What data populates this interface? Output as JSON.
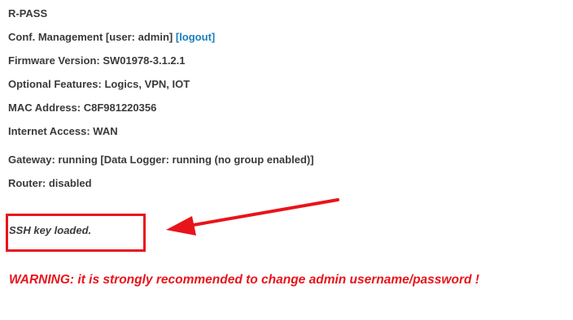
{
  "device": {
    "name": "R-PASS"
  },
  "conf_management": {
    "prefix": "Conf. Management [user: admin] ",
    "logout_label": "[logout]"
  },
  "firmware": {
    "label": "Firmware Version: SW01978-3.1.2.1"
  },
  "optional_features": {
    "label": "Optional Features: Logics, VPN, IOT"
  },
  "mac_address": {
    "label": "MAC Address: C8F981220356"
  },
  "internet_access": {
    "label": "Internet Access: WAN"
  },
  "gateway": {
    "label": "Gateway: running [Data Logger: running (no group enabled)]"
  },
  "router": {
    "label": "Router: disabled"
  },
  "ssh": {
    "message": "SSH key loaded."
  },
  "warning": {
    "message": "WARNING: it is strongly recommended to change admin username/password !"
  },
  "colors": {
    "text": "#3a3a3a",
    "link": "#1a7fbf",
    "warning": "#e8141b",
    "annotation": "#e8141b"
  }
}
